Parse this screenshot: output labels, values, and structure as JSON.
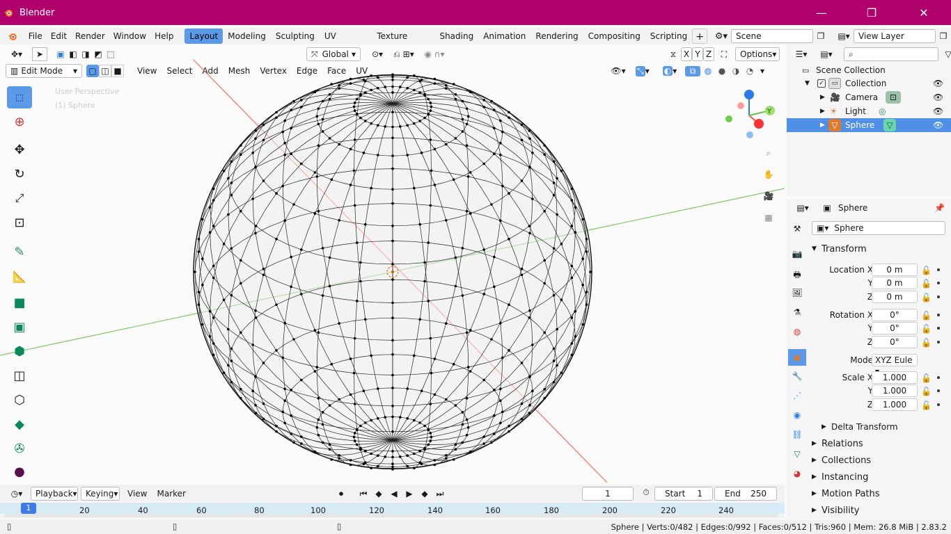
{
  "window": {
    "title": "Blender",
    "minimize": "—",
    "maximize": "❐",
    "close": "✕"
  },
  "menus": [
    "File",
    "Edit",
    "Render",
    "Window",
    "Help"
  ],
  "workspaces": [
    "Layout",
    "Modeling",
    "Sculpting",
    "UV Editing",
    "Texture Paint",
    "Shading",
    "Animation",
    "Rendering",
    "Compositing",
    "Scripting"
  ],
  "scene": {
    "label": "Scene"
  },
  "view_layer": {
    "label": "View Layer"
  },
  "viewport": {
    "mode": "Edit Mode",
    "menus": [
      "View",
      "Select",
      "Add",
      "Mesh",
      "Vertex",
      "Edge",
      "Face",
      "UV"
    ],
    "orientation": "Global",
    "axes": [
      "X",
      "Y",
      "Z"
    ],
    "options": "Options",
    "overlay_text": [
      "User Perspective",
      "(1) Sphere"
    ],
    "gizmo": {
      "y": "Y"
    }
  },
  "outliner": {
    "root": "Scene Collection",
    "collection": "Collection",
    "items": [
      "Camera",
      "Light",
      "Sphere"
    ],
    "selected": "Sphere"
  },
  "properties": {
    "object_name": "Sphere",
    "datablock": "Sphere",
    "transform": "Transform",
    "location_label": "Location X",
    "rotation_label": "Rotation X",
    "scale_label": "Scale X",
    "y": "Y",
    "z": "Z",
    "location": [
      "0 m",
      "0 m",
      "0 m"
    ],
    "rotation": [
      "0°",
      "0°",
      "0°"
    ],
    "mode_label": "Mode",
    "mode_value": "XYZ Eule",
    "scale": [
      "1.000",
      "1.000",
      "1.000"
    ],
    "delta": "Delta Transform",
    "sections": [
      "Relations",
      "Collections",
      "Instancing",
      "Motion Paths",
      "Visibility"
    ]
  },
  "timeline": {
    "menus": [
      "Playback",
      "Keying",
      "View",
      "Marker"
    ],
    "current_frame": "1",
    "start_label": "Start",
    "start": "1",
    "end_label": "End",
    "end": "250",
    "ticks": [
      "1",
      "20",
      "40",
      "60",
      "80",
      "100",
      "120",
      "140",
      "160",
      "180",
      "200",
      "220",
      "240"
    ]
  },
  "status": "Sphere | Verts:0/482 | Edges:0/992 | Faces:0/512 | Tris:960 | Mem: 26.8 MiB | 2.83.2",
  "colors": {
    "titlebar": "#b0006c",
    "accent": "#5b9ae8",
    "selected_row": "#4f8fe6",
    "x_axis": "#ff4a4a",
    "y_axis": "#6cc14a",
    "z_axis": "#2d7be6"
  }
}
